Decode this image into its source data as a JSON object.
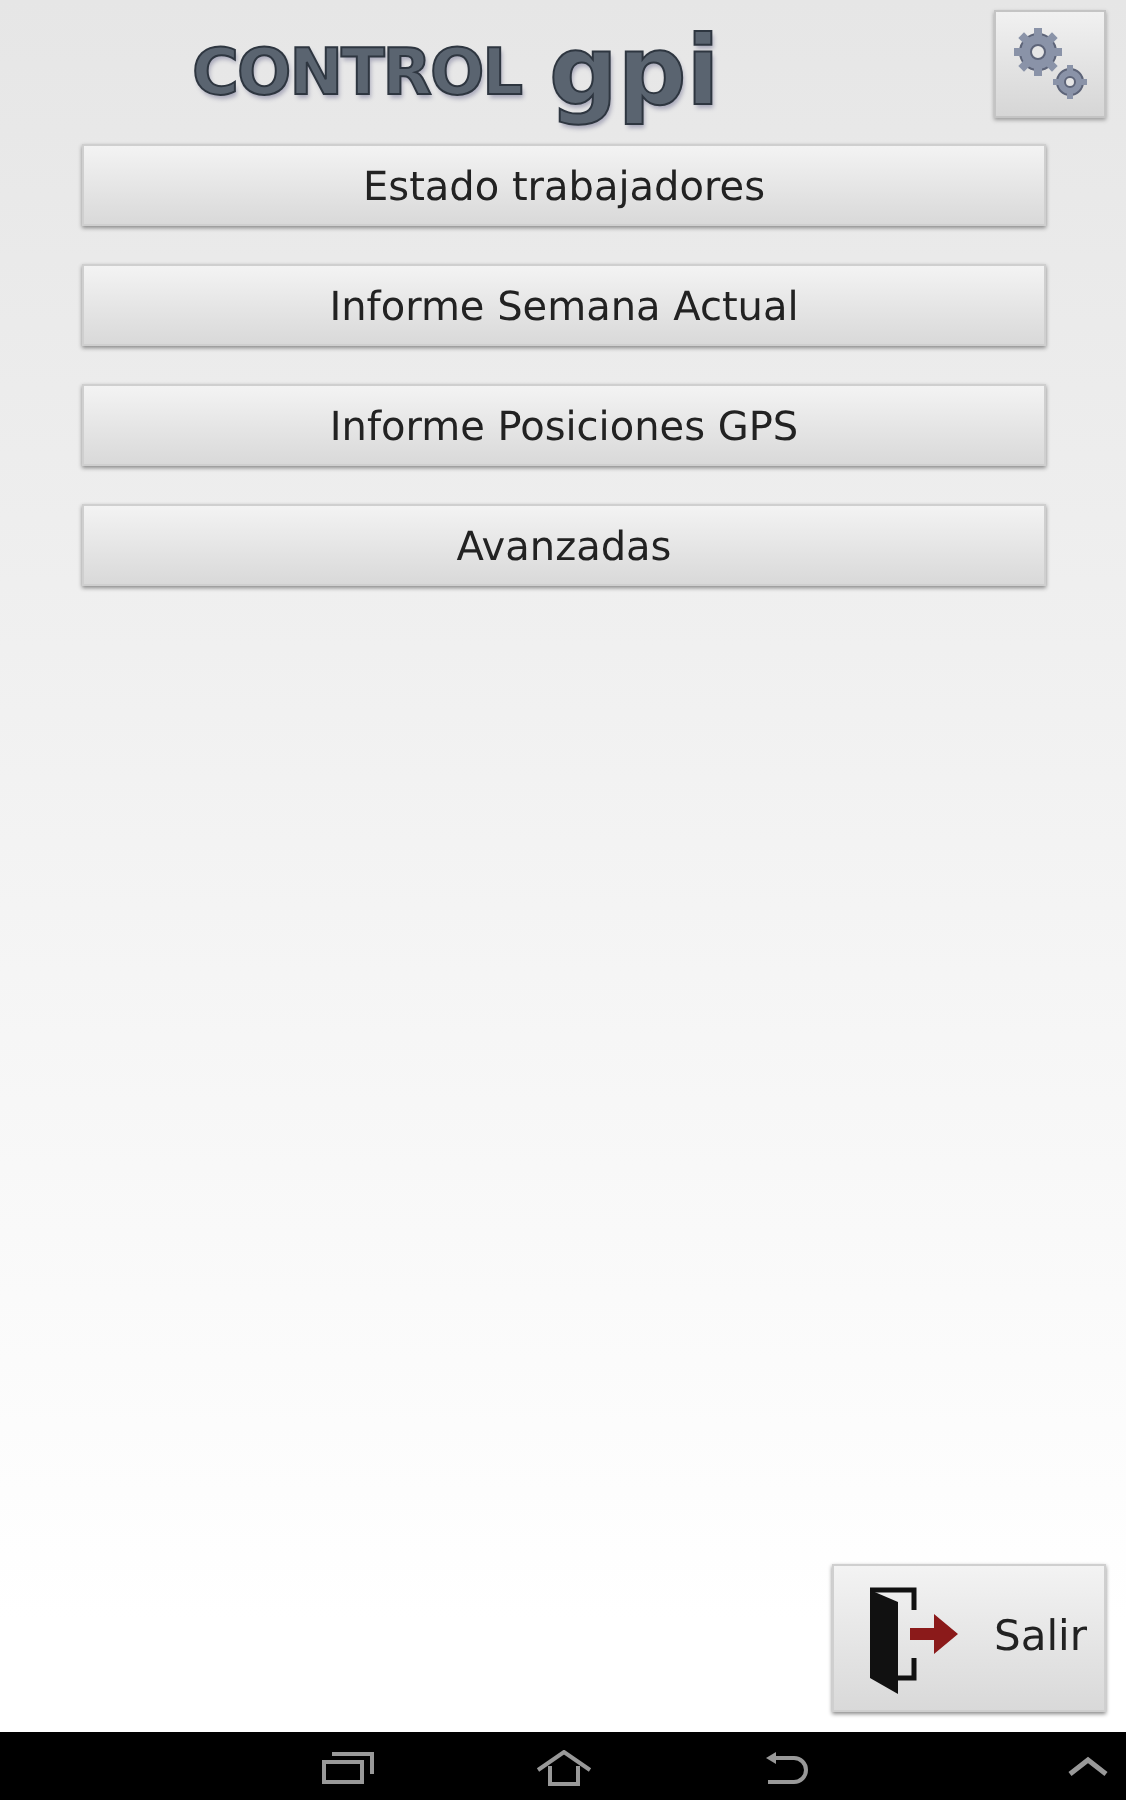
{
  "logo": {
    "word_1": "CONTROL",
    "word_2": "gpi"
  },
  "menu_buttons": [
    {
      "label": "Estado trabajadores"
    },
    {
      "label": "Informe Semana Actual"
    },
    {
      "label": "Informe Posiciones GPS"
    },
    {
      "label": "Avanzadas"
    }
  ],
  "exit_button": {
    "label": "Salir"
  }
}
